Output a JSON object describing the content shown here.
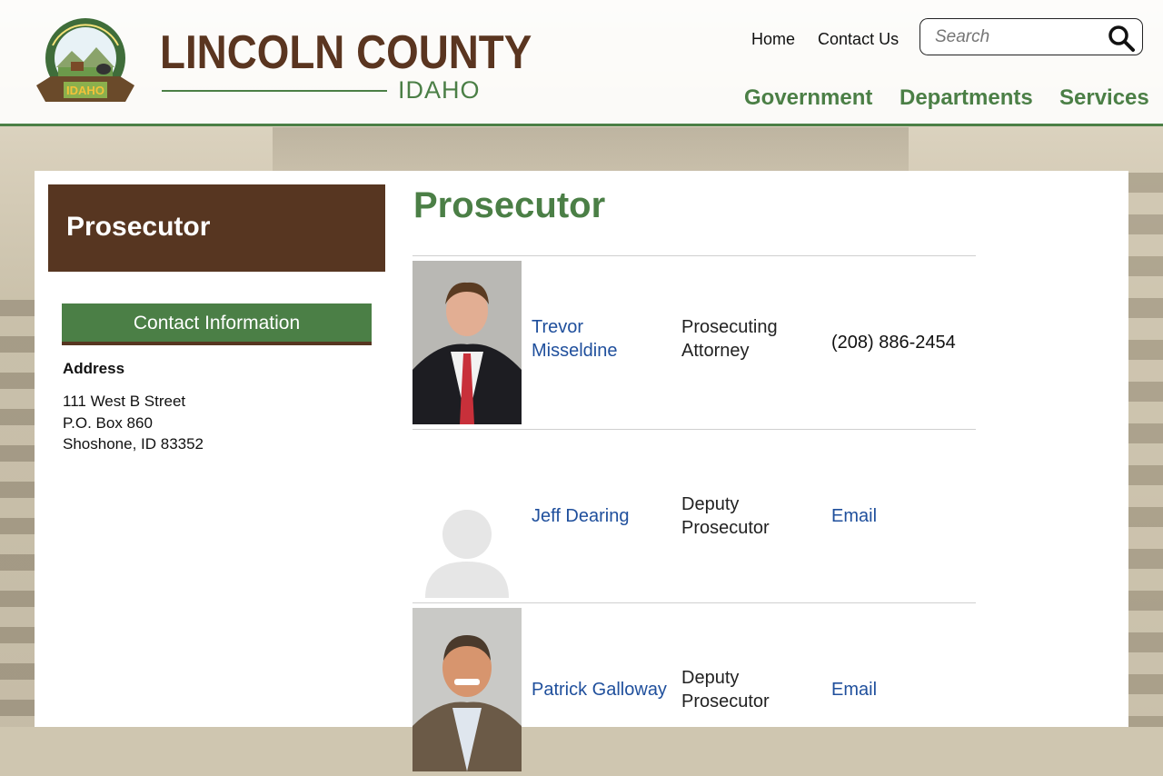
{
  "site": {
    "title": "LINCOLN COUNTY",
    "subtitle": "IDAHO",
    "seal_text_top": "LINCOLN COUNTY",
    "seal_text_bottom": "IDAHO"
  },
  "top_links": {
    "home": "Home",
    "contact": "Contact Us"
  },
  "search": {
    "placeholder": "Search"
  },
  "main_nav": [
    "Government",
    "Departments",
    "Services"
  ],
  "sidebar": {
    "title": "Prosecutor",
    "contact_heading": "Contact Information",
    "address_label": "Address",
    "address_lines": [
      "111 West B Street",
      "P.O. Box 860",
      "Shoshone, ID 83352"
    ]
  },
  "page": {
    "title": "Prosecutor"
  },
  "staff": [
    {
      "name_line1": "Trevor",
      "name_line2": "Misseldine",
      "role_line1": "Prosecuting",
      "role_line2": "Attorney",
      "contact": "(208) 886-2454",
      "contact_is_link": false,
      "photo": "photo-portrait"
    },
    {
      "name_line1": "Jeff Dearing",
      "name_line2": "",
      "role_line1": "Deputy",
      "role_line2": "Prosecutor",
      "contact": "Email",
      "contact_is_link": true,
      "photo": "placeholder-avatar"
    },
    {
      "name_line1": "Patrick Galloway",
      "name_line2": "",
      "role_line1": "Deputy",
      "role_line2": "Prosecutor",
      "contact": "Email",
      "contact_is_link": true,
      "photo": "photo-portrait"
    }
  ],
  "colors": {
    "green": "#4b7f46",
    "brown": "#573621",
    "link": "#1f4f9c"
  }
}
